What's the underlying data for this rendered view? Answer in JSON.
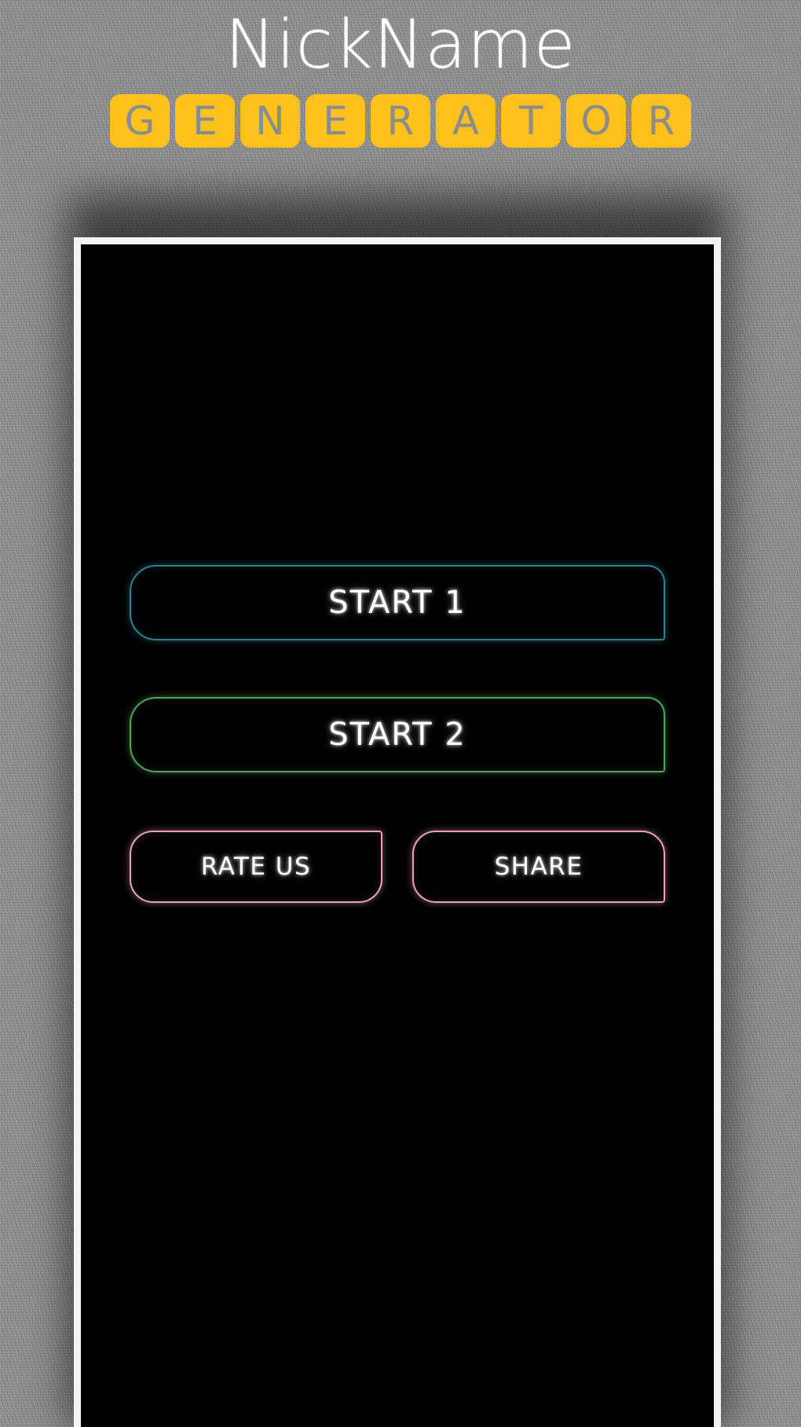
{
  "header": {
    "app_title": "NickName",
    "subtitle_word": "GENERATOR",
    "subtitle_letters": [
      "G",
      "E",
      "N",
      "E",
      "R",
      "A",
      "T",
      "O",
      "R"
    ],
    "tile_color": "#fcc21b",
    "tile_letter_color": "#8c8c8c",
    "title_color": "#ffffff"
  },
  "background": {
    "color": "#9c9c9c",
    "texture": "noise"
  },
  "phone": {
    "frame_color": "#f4f4f4",
    "screen_color": "#010101"
  },
  "screen": {
    "buttons": {
      "start_1": {
        "label": "START 1",
        "accent": "#2f7f8f"
      },
      "start_2": {
        "label": "START 2",
        "accent": "#4fa35c"
      },
      "rate_us": {
        "label": "RATE US",
        "accent": "#e6a3b8"
      },
      "share": {
        "label": "SHARE",
        "accent": "#e6a3b8"
      }
    }
  }
}
